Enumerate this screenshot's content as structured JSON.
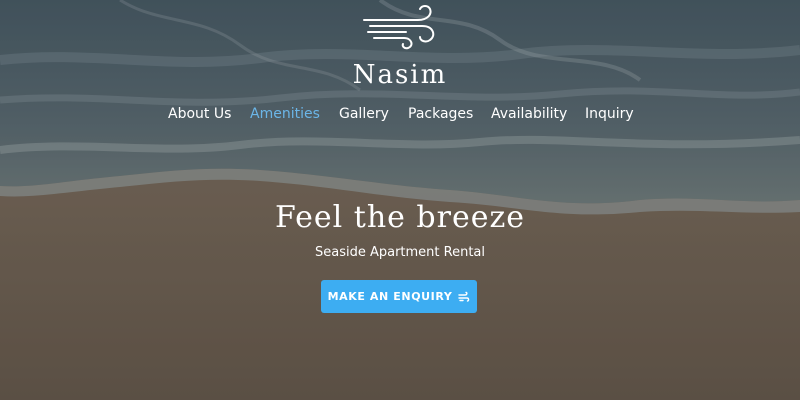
{
  "brand": {
    "name": "Nasim"
  },
  "nav": {
    "items": [
      {
        "label": "About Us",
        "active": false
      },
      {
        "label": "Amenities",
        "active": true
      },
      {
        "label": "Gallery",
        "active": false
      },
      {
        "label": "Packages",
        "active": false
      },
      {
        "label": "Availability",
        "active": false
      },
      {
        "label": "Inquiry",
        "active": false
      }
    ]
  },
  "hero": {
    "tagline": "Feel the breeze",
    "subtitle": "Seaside Apartment Rental",
    "cta_label": "MAKE AN ENQUIRY",
    "cta_icon": "wind-icon"
  },
  "colors": {
    "accent": "#3dadf2",
    "nav_active": "#6bb6e8",
    "text": "#ffffff"
  }
}
